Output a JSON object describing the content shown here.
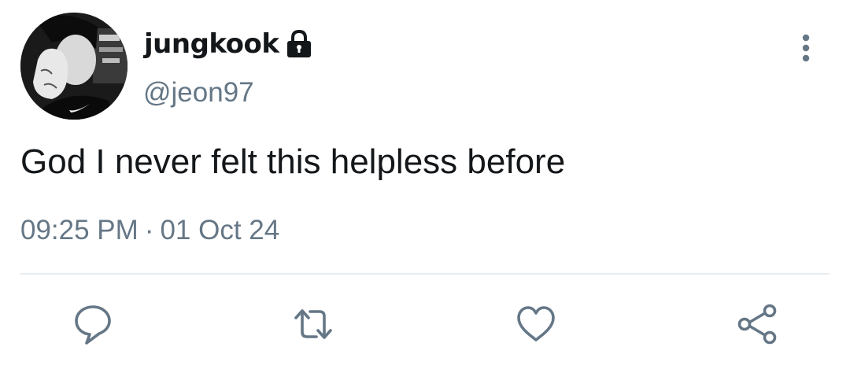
{
  "tweet": {
    "author": {
      "display_name": "jungkook",
      "handle": "@jeon97",
      "protected": true,
      "avatar_icon": "avatar-photo"
    },
    "text": "God I never felt this helpless before",
    "time": "09:25 PM",
    "separator": "·",
    "date": "01 Oct 24"
  },
  "actions": [
    {
      "name": "reply",
      "icon": "reply-icon"
    },
    {
      "name": "retweet",
      "icon": "retweet-icon"
    },
    {
      "name": "like",
      "icon": "heart-icon"
    },
    {
      "name": "share",
      "icon": "share-icon"
    }
  ],
  "menu": {
    "icon": "more-vertical-icon"
  },
  "colors": {
    "text_primary": "#14171a",
    "text_secondary": "#657786",
    "divider": "#e6ecf0",
    "icon": "#657786"
  }
}
